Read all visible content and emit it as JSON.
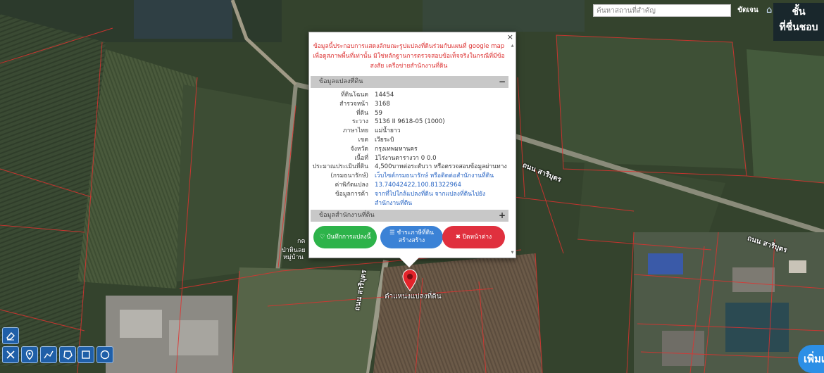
{
  "search": {
    "placeholder": "ค้นหาสถานที่สำคัญ",
    "button": "ขัดเจน"
  },
  "layers": {
    "line1": "ชั้น",
    "line2": "ที่ชื่นชอบ"
  },
  "map": {
    "road_label_1": "ถนน สาริบุตร",
    "road_label_2": "ถนน สาริบุตร",
    "road_label_3": "ถนน สาริบุตร",
    "left_label_1": "ป่าหินลย",
    "left_label_2": "หมู่บ้าน",
    "left_label_3": "กต",
    "marker_label": "ตำแหน่งแปลงที่ดิน"
  },
  "popup": {
    "close": "×",
    "disclaimer": "ข้อมูลนี้ประกอบการแสดงลักษณะรูปแปลงที่ดินร่วมกับแผนที่ google map เพื่อดูสภาพพื้นที่เท่านั้น มิใช่หลักฐานการตรวจสอบข้อเท็จจริงในกรณีที่มีข้อสงสัย เครือข่ายสำนักงานที่ดิน",
    "section1": {
      "title": "ข้อมูลแปลงที่ดิน",
      "toggle": "−"
    },
    "section2": {
      "title": "ข้อมูลสำนักงานที่ดิน",
      "toggle": "+"
    },
    "rows": [
      {
        "label": "ที่ดินโฉนด",
        "value": "14454"
      },
      {
        "label": "สำรวจหน้า",
        "value": "3168"
      },
      {
        "label": "ที่ดิน",
        "value": "59"
      },
      {
        "label": "ระวาง",
        "value": "5136 II 9618-05 (1000)"
      },
      {
        "label": "ภาษาไทย",
        "value": "แม่น้ำยาว"
      },
      {
        "label": "เขต",
        "value": "เวียระบิ"
      },
      {
        "label": "จังหวัด",
        "value": "กรุงเทพมหานคร"
      },
      {
        "label": "เนื้อที่",
        "value": "1ไร่งานตารางวา 0 0.0"
      },
      {
        "label": "ประมาณประเมินที่ดิน",
        "value": "4,500บาทต่อระดับวา หรือตรวจสอบข้อมูลผ่านทาง"
      },
      {
        "label": "(กรมธนารักษ์)",
        "value": "เว็บไซต์กรมธนารักษ์ หรือติดต่อสำนักงานที่ดิน"
      },
      {
        "label": "ค่าพิกัดแปลง",
        "value": "13.74042422,100.81322964"
      },
      {
        "label": "ข้อมูลการค้า",
        "value": "จากที่ไปใกล้แปลงที่ดิน จากแปลงที่ดินไปยัง"
      },
      {
        "label": "",
        "value": "สำนักงานที่ดิน"
      }
    ],
    "buttons": {
      "note": "♡ บันทึกการแปลงนี้",
      "pay": "☰ ชำระภาษีที่ดิน สร้างสร้าง",
      "close": "✖ ปิดหน้าต่าง"
    }
  },
  "add_button": "เพิ่มเ",
  "tools": [
    "eraser-icon",
    "ruler-icon",
    "pin-icon",
    "polyline-icon",
    "polygon-icon",
    "rectangle-icon",
    "circle-icon"
  ]
}
